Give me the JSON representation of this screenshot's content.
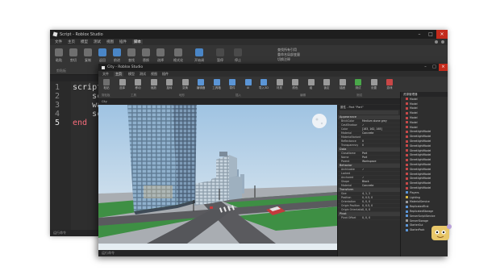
{
  "back_window": {
    "title": "Script - Roblox Studio",
    "menu": [
      "文件",
      "主页",
      "模型",
      "测试",
      "视图",
      "插件",
      "脚本"
    ],
    "active_menu": "脚本",
    "ribbon_buttons": [
      "粘贴",
      "剪切",
      "复制",
      "返回",
      "前进",
      "查找",
      "替换",
      "选择",
      "格式化",
      "开始调试",
      "暂停",
      "停止"
    ],
    "ribbon_groups": [
      "剪贴板",
      "导航",
      "编辑",
      "格式",
      "调试"
    ],
    "ribbon_right_text": [
      "查找所有引用",
      "重命名局部变量",
      "切换注释"
    ],
    "code_lines": [
      {
        "no": "1",
        "text": "script."
      },
      {
        "no": "2",
        "text": "    scr"
      },
      {
        "no": "3",
        "text": "    wai"
      },
      {
        "no": "4",
        "text": "    scr"
      },
      {
        "no": "5",
        "text": "end"
      }
    ],
    "status": "运行命令"
  },
  "front_window": {
    "title": "City - Roblox Studio",
    "menu": [
      "文件",
      "主页",
      "模型",
      "测试",
      "视图",
      "插件"
    ],
    "active_menu": "主页",
    "ribbon_buttons": [
      "粘贴",
      "选择",
      "移动",
      "缩放",
      "旋转",
      "变换",
      "编辑器",
      "工具箱",
      "零件",
      "UI",
      "导入3D",
      "材质",
      "颜色",
      "组",
      "锁定",
      "锚固",
      "测试",
      "设置",
      "游戏"
    ],
    "ribbon_groups": [
      "剪贴板",
      "工具",
      "地形",
      "插入",
      "编辑",
      "测试"
    ],
    "viewport_tab": "City",
    "status": "运行命令",
    "properties": {
      "header": "属性 - Part \"Part\"",
      "sections": [
        {
          "name": "Appearance",
          "rows": [
            {
              "k": "BrickColor",
              "v": "Medium stone grey"
            },
            {
              "k": "CastShadow",
              "v": "✓"
            },
            {
              "k": "Color",
              "v": "[163, 162, 165]"
            },
            {
              "k": "Material",
              "v": "Concrete"
            },
            {
              "k": "MaterialVariant",
              "v": ""
            },
            {
              "k": "Reflectance",
              "v": "0"
            },
            {
              "k": "Transparency",
              "v": "0"
            }
          ]
        },
        {
          "name": "Data",
          "rows": [
            {
              "k": "ClassName",
              "v": "Part"
            },
            {
              "k": "Name",
              "v": "Part"
            },
            {
              "k": "Parent",
              "v": "Workspace"
            }
          ]
        },
        {
          "name": "Behavior",
          "rows": [
            {
              "k": "Archivable",
              "v": "✓"
            },
            {
              "k": "Locked",
              "v": ""
            },
            {
              "k": "Anchored",
              "v": "✓"
            },
            {
              "k": "Shape",
              "v": "Block"
            },
            {
              "k": "Material",
              "v": "Concrete"
            }
          ]
        },
        {
          "name": "Transform",
          "rows": [
            {
              "k": "Size",
              "v": "4, 1, 2"
            },
            {
              "k": "Position",
              "v": "0, 0.5, 0"
            },
            {
              "k": "Orientation",
              "v": "0, 0, 0"
            },
            {
              "k": "Origin Position",
              "v": "0, 0.5, 0"
            },
            {
              "k": "Origin Orientation",
              "v": "0, 0, 0"
            }
          ]
        },
        {
          "name": "Pivot",
          "rows": [
            {
              "k": "Pivot Offset",
              "v": "0, 0, 0"
            }
          ]
        }
      ]
    },
    "explorer": {
      "header": "资源管理器",
      "items": [
        {
          "label": "Model",
          "color": "red"
        },
        {
          "label": "Model",
          "color": "red"
        },
        {
          "label": "Model",
          "color": "red"
        },
        {
          "label": "Model",
          "color": "red"
        },
        {
          "label": "Model",
          "color": "red"
        },
        {
          "label": "Model",
          "color": "red"
        },
        {
          "label": "Model",
          "color": "red"
        },
        {
          "label": "StreetlightModel",
          "color": "red"
        },
        {
          "label": "StreetlightModel",
          "color": "red"
        },
        {
          "label": "StreetlightModel",
          "color": "red"
        },
        {
          "label": "StreetlightModel",
          "color": "red"
        },
        {
          "label": "StreetlightModel",
          "color": "red"
        },
        {
          "label": "StreetlightModel",
          "color": "red"
        },
        {
          "label": "StreetlightModel",
          "color": "red"
        },
        {
          "label": "StreetlightModel",
          "color": "red"
        },
        {
          "label": "StreetlightModel",
          "color": "red"
        },
        {
          "label": "StreetlightModel",
          "color": "red"
        },
        {
          "label": "StreetlightModel",
          "color": "red"
        },
        {
          "label": "StreetlightModel",
          "color": "red"
        },
        {
          "label": "StreetlightModel",
          "color": "red"
        },
        {
          "label": "Players",
          "color": "blue"
        },
        {
          "label": "Lighting",
          "color": "yel"
        },
        {
          "label": "MaterialService",
          "color": "grey"
        },
        {
          "label": "ReplicatedFirst",
          "color": "blue"
        },
        {
          "label": "ReplicatedStorage",
          "color": "blue"
        },
        {
          "label": "ServerScriptService",
          "color": "blue"
        },
        {
          "label": "ServerStorage",
          "color": "grey"
        },
        {
          "label": "StarterGui",
          "color": "blue"
        },
        {
          "label": "StarterPack",
          "color": "blue"
        }
      ]
    }
  },
  "colors": {
    "keyword": "#f86d7c",
    "close": "#c42b1c",
    "sky_top": "#bcd6ec",
    "road": "#5a5a5e",
    "grass": "#3e8f44"
  }
}
